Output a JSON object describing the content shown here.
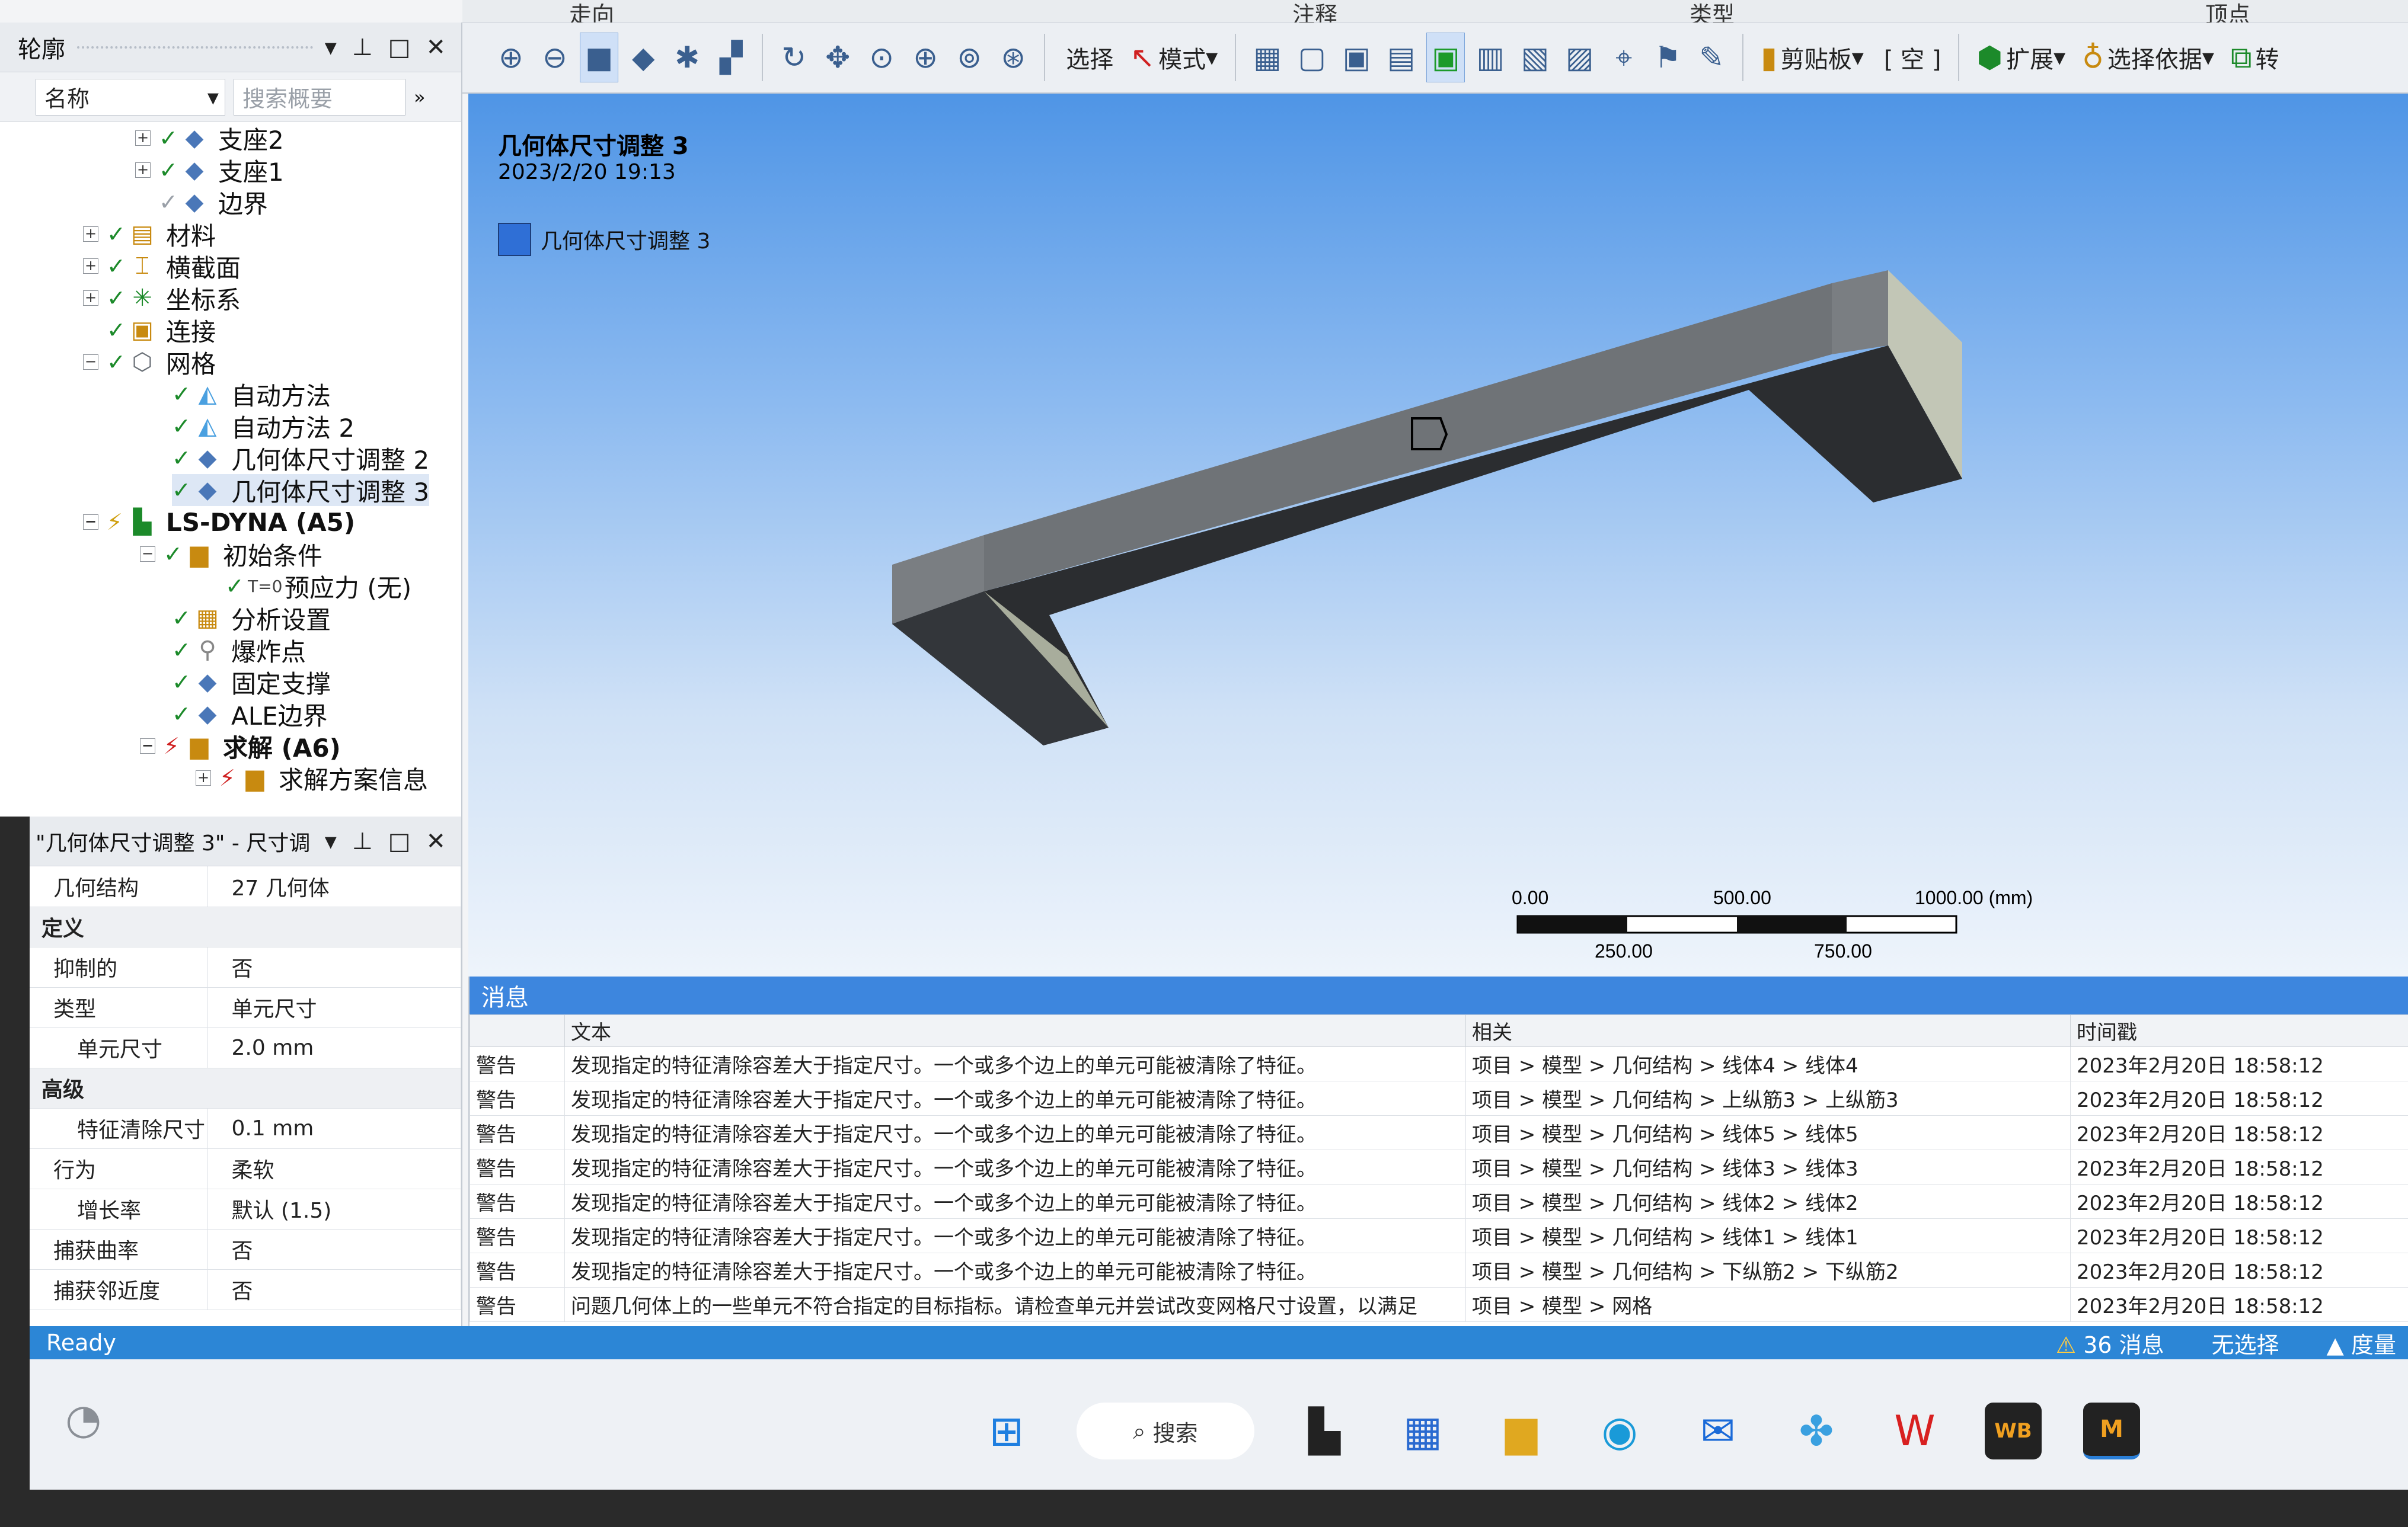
{
  "ribbon": {
    "tabs": [
      "走向",
      "注释",
      "类型",
      "顶点"
    ]
  },
  "toolbar": {
    "select_label": "选择",
    "mode_label": "模式",
    "clipboard_label": "剪贴板",
    "empty_label": "[ 空 ]",
    "extend_label": "扩展",
    "select_by_label": "选择依据",
    "convert_label": "转"
  },
  "outline": {
    "title": "轮廓",
    "filter_name": "名称",
    "search_placeholder": "搜索概要",
    "nodes": [
      {
        "label": "支座2"
      },
      {
        "label": "支座1"
      },
      {
        "label": "边界"
      },
      {
        "label": "材料"
      },
      {
        "label": "横截面"
      },
      {
        "label": "坐标系"
      },
      {
        "label": "连接"
      },
      {
        "label": "网格"
      },
      {
        "label": "自动方法"
      },
      {
        "label": "自动方法 2"
      },
      {
        "label": "几何体尺寸调整 2"
      },
      {
        "label": "几何体尺寸调整 3"
      },
      {
        "label": "LS-DYNA (A5)"
      },
      {
        "label": "初始条件"
      },
      {
        "label": "预应力 (无)"
      },
      {
        "label": "分析设置"
      },
      {
        "label": "爆炸点"
      },
      {
        "label": "固定支撑"
      },
      {
        "label": "ALE边界"
      },
      {
        "label": "求解 (A6)"
      },
      {
        "label": "求解方案信息"
      }
    ],
    "icon_t0": "T=0"
  },
  "details": {
    "title": "\"几何体尺寸调整 3\" - 尺寸调",
    "rows": [
      {
        "key": "几何结构",
        "value": "27 几何体"
      },
      {
        "group": "定义"
      },
      {
        "key": "抑制的",
        "value": "否"
      },
      {
        "key": "类型",
        "value": "单元尺寸"
      },
      {
        "key": "单元尺寸",
        "value": "2.0 mm"
      },
      {
        "group": "高级"
      },
      {
        "key": "特征清除尺寸",
        "value": "0.1 mm"
      },
      {
        "key": "行为",
        "value": "柔软"
      },
      {
        "key": "增长率",
        "value": "默认 (1.5)"
      },
      {
        "key": "捕获曲率",
        "value": "否"
      },
      {
        "key": "捕获邻近度",
        "value": "否"
      }
    ]
  },
  "viewport": {
    "title": "几何体尺寸调整 3",
    "date": "2023/2/20 19:13",
    "legend": "几何体尺寸调整 3",
    "scale": {
      "t0": "0.00",
      "t500": "500.00",
      "t1000": "1000.00 (mm)",
      "t250": "250.00",
      "t750": "750.00"
    }
  },
  "messages": {
    "title": "消息",
    "cols": {
      "text": "文本",
      "related": "相关",
      "time": "时间戳"
    },
    "rows": [
      {
        "type": "警告",
        "text": "发现指定的特征清除容差大于指定尺寸。一个或多个边上的单元可能被清除了特征。",
        "related": "项目 > 模型 > 几何结构 > 线体4 > 线体4",
        "time": "2023年2月20日 18:58:12"
      },
      {
        "type": "警告",
        "text": "发现指定的特征清除容差大于指定尺寸。一个或多个边上的单元可能被清除了特征。",
        "related": "项目 > 模型 > 几何结构 > 上纵筋3 > 上纵筋3",
        "time": "2023年2月20日 18:58:12"
      },
      {
        "type": "警告",
        "text": "发现指定的特征清除容差大于指定尺寸。一个或多个边上的单元可能被清除了特征。",
        "related": "项目 > 模型 > 几何结构 > 线体5 > 线体5",
        "time": "2023年2月20日 18:58:12"
      },
      {
        "type": "警告",
        "text": "发现指定的特征清除容差大于指定尺寸。一个或多个边上的单元可能被清除了特征。",
        "related": "项目 > 模型 > 几何结构 > 线体3 > 线体3",
        "time": "2023年2月20日 18:58:12"
      },
      {
        "type": "警告",
        "text": "发现指定的特征清除容差大于指定尺寸。一个或多个边上的单元可能被清除了特征。",
        "related": "项目 > 模型 > 几何结构 > 线体2 > 线体2",
        "time": "2023年2月20日 18:58:12"
      },
      {
        "type": "警告",
        "text": "发现指定的特征清除容差大于指定尺寸。一个或多个边上的单元可能被清除了特征。",
        "related": "项目 > 模型 > 几何结构 > 线体1 > 线体1",
        "time": "2023年2月20日 18:58:12"
      },
      {
        "type": "警告",
        "text": "发现指定的特征清除容差大于指定尺寸。一个或多个边上的单元可能被清除了特征。",
        "related": "项目 > 模型 > 几何结构 > 下纵筋2 > 下纵筋2",
        "time": "2023年2月20日 18:58:12"
      },
      {
        "type": "警告",
        "text": "问题几何体上的一些单元不符合指定的目标指标。请检查单元并尝试改变网格尺寸设置，以满足",
        "related": "项目 > 模型 > 网格",
        "time": "2023年2月20日 18:58:12"
      }
    ]
  },
  "status": {
    "ready": "Ready",
    "messages": "36 消息",
    "no_selection": "无选择",
    "measure": "度量"
  },
  "taskbar": {
    "search": "搜索",
    "wb_label": "WB",
    "m_label": "M"
  },
  "colors": {
    "accent": "#2c86d6",
    "viewport_top": "#4f95e6",
    "body_color": "#6f7377"
  }
}
